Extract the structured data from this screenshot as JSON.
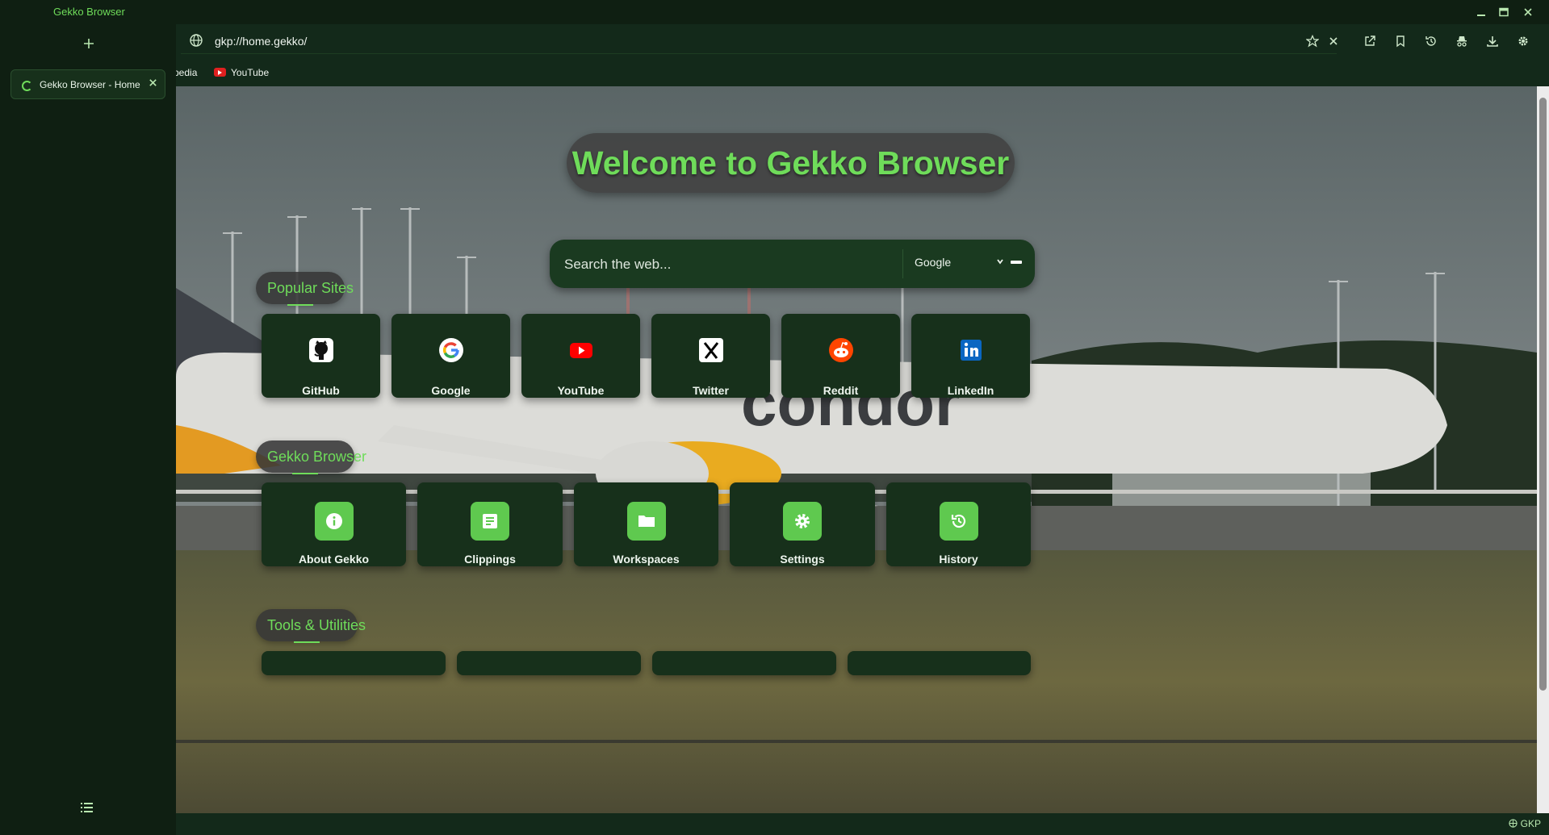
{
  "window": {
    "title": "Gekko Browser"
  },
  "sidebar": {
    "new_tab_icon": "plus-icon",
    "tabs": [
      {
        "label": "Gekko Browser - Home"
      }
    ],
    "menu_icon": "list-icon"
  },
  "address": {
    "url": "gkp://home.gekko/"
  },
  "bookmarks": [
    {
      "label": "pedia"
    },
    {
      "label": "YouTube"
    }
  ],
  "home": {
    "welcome": "Welcome to Gekko Browser",
    "search": {
      "placeholder": "Search the web...",
      "engine": "Google"
    },
    "sections": [
      {
        "title": "Popular Sites",
        "items": [
          "GitHub",
          "Google",
          "YouTube",
          "Twitter",
          "Reddit",
          "LinkedIn"
        ]
      },
      {
        "title": "Gekko Browser",
        "items": [
          "About Gekko",
          "Clippings",
          "Workspaces",
          "Settings",
          "History"
        ]
      },
      {
        "title": "Tools & Utilities",
        "items": []
      }
    ]
  },
  "status": {
    "label": "GKP"
  },
  "colors": {
    "accent": "#6fdc5a",
    "panel": "#17301b",
    "background": "#0f1f12"
  }
}
